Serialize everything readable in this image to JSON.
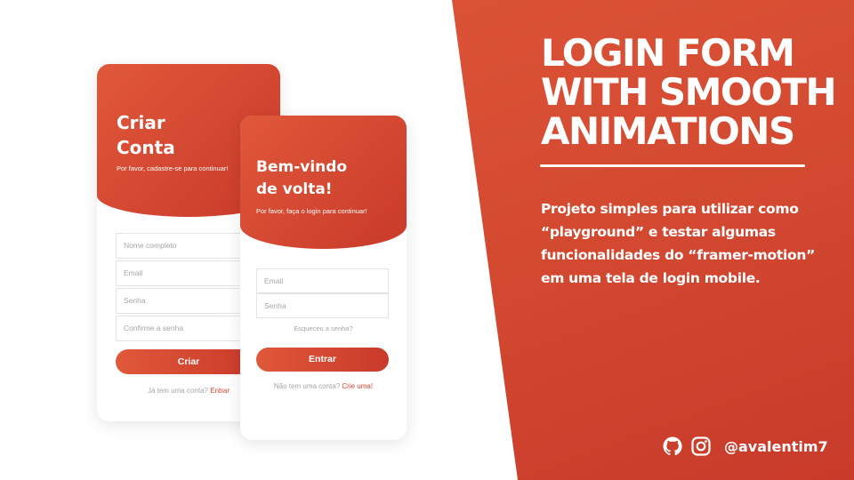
{
  "title_lines": [
    "LOGIN FORM",
    "WITH SMOOTH",
    "ANIMATIONS"
  ],
  "description": "Projeto simples para utilizar como “playground” e testar algumas funcionalidades do “framer-motion” em uma tela de login mobile.",
  "social": {
    "icons": [
      "github-icon",
      "instagram-icon"
    ],
    "handle": "@avalentim7"
  },
  "colors": {
    "accent": "#d34a31",
    "accent_dark": "#c93a2a",
    "accent_light": "#e0583a",
    "link": "#d9452f"
  },
  "signup": {
    "title": "Criar\nConta",
    "subtitle": "Por favor, cadastre-se para continuar!",
    "placeholders": {
      "name": "Nome completo",
      "email": "Email",
      "password": "Senha",
      "confirm": "Confirme a senha"
    },
    "button": "Criar",
    "footer_text": "Já tem uma conta?",
    "footer_link": "Entrar"
  },
  "login": {
    "title": "Bem-vindo\nde volta!",
    "subtitle": "Por favor, faça o login para continuar!",
    "placeholders": {
      "email": "Email",
      "password": "Senha"
    },
    "forgot": "Esqueceu a senha?",
    "button": "Entrar",
    "footer_text": "Não tem uma conta?",
    "footer_link": "Crie uma!"
  }
}
